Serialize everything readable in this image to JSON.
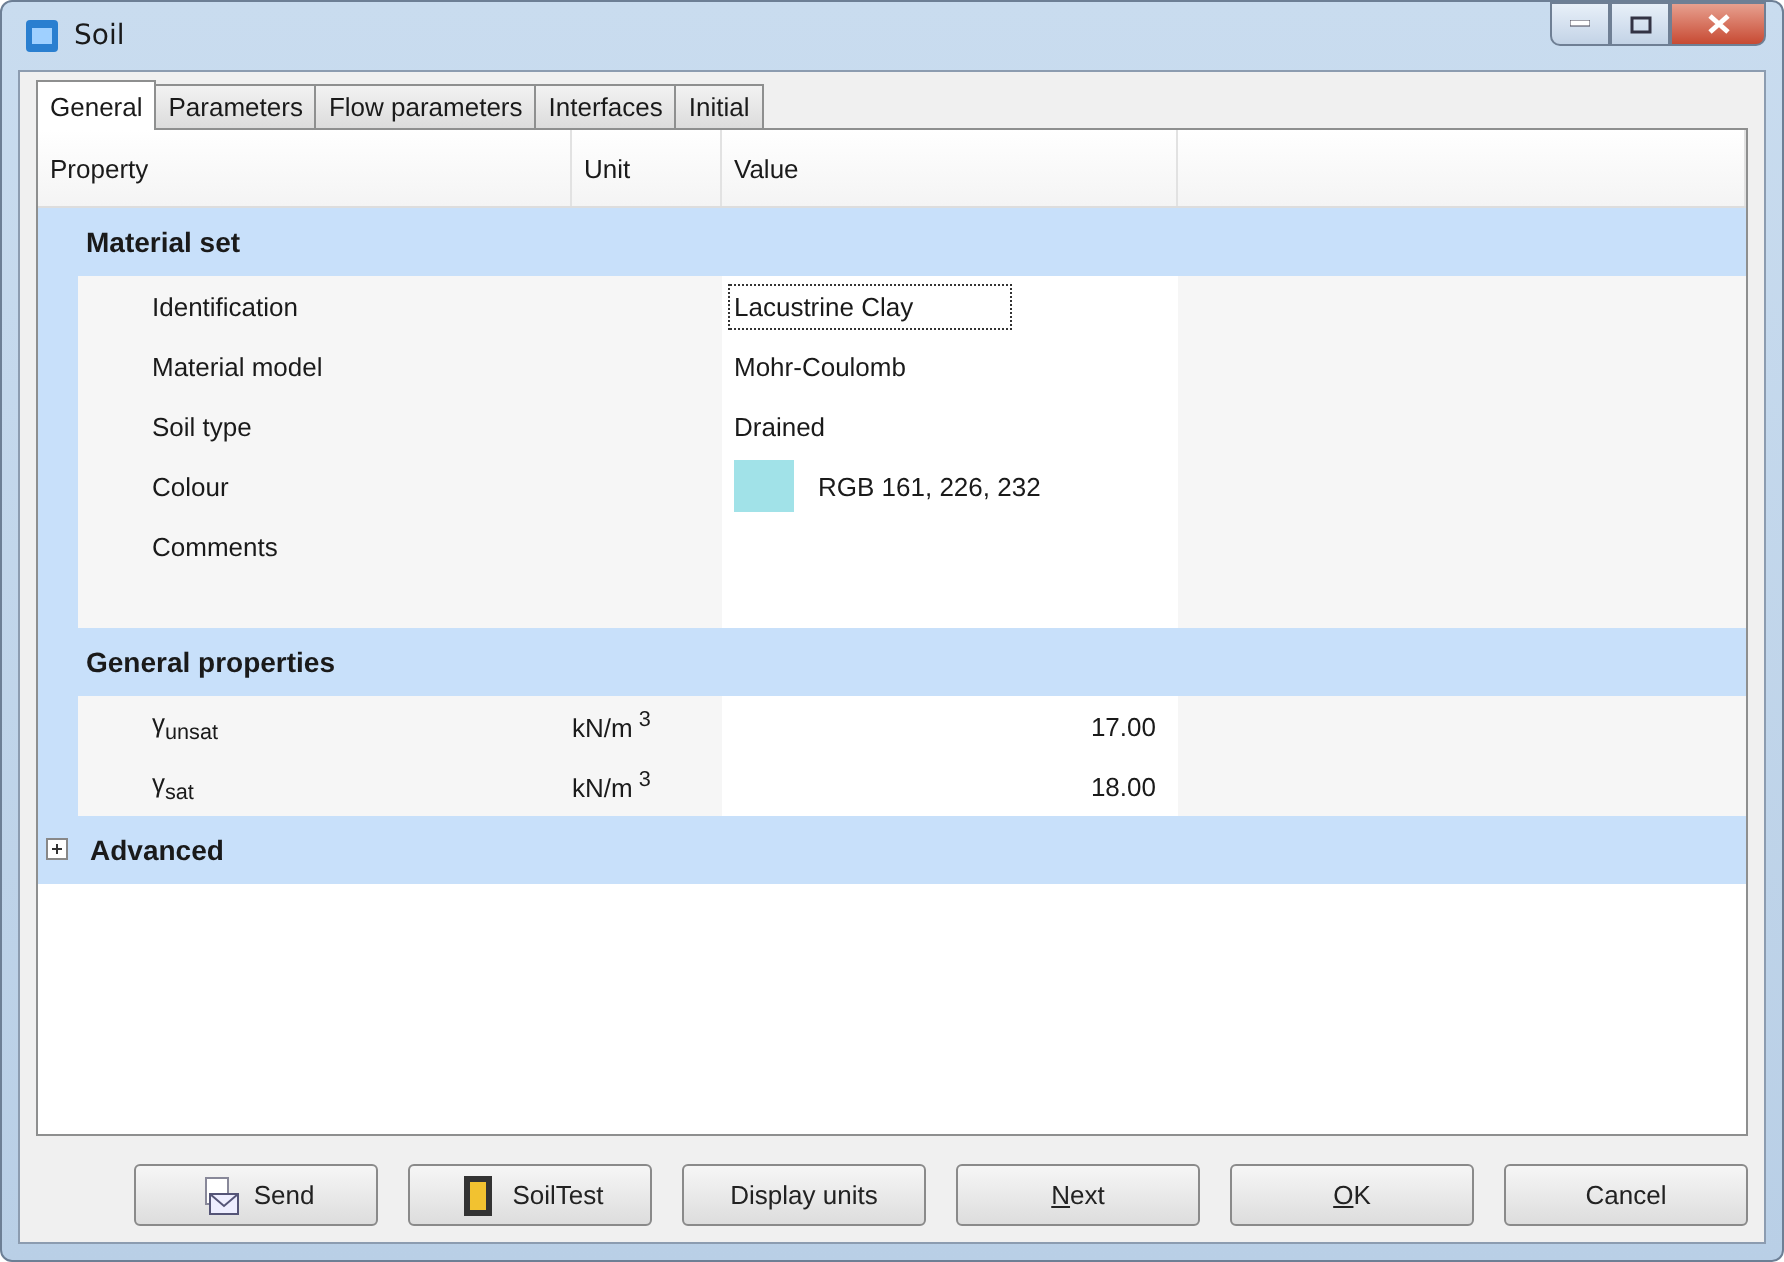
{
  "window": {
    "title": "Soil"
  },
  "tabs": [
    {
      "label": "General",
      "selected": true
    },
    {
      "label": "Parameters",
      "selected": false
    },
    {
      "label": "Flow parameters",
      "selected": false
    },
    {
      "label": "Interfaces",
      "selected": false
    },
    {
      "label": "Initial",
      "selected": false
    }
  ],
  "columns": [
    "Property",
    "Unit",
    "Value"
  ],
  "sections": [
    {
      "title": "Material set",
      "expanded": true,
      "rows": [
        {
          "kind": "text",
          "property": "Identification",
          "value": "Lacustrine Clay",
          "focused": true
        },
        {
          "kind": "text",
          "property": "Material model",
          "value": "Mohr-Coulomb",
          "focused": false
        },
        {
          "kind": "text",
          "property": "Soil type",
          "value": "Drained",
          "focused": false
        },
        {
          "kind": "color",
          "property": "Colour",
          "value": "RGB 161, 226, 232",
          "color": "#a1e2e8",
          "focused": false
        },
        {
          "kind": "memo",
          "property": "Comments"
        }
      ]
    },
    {
      "title": "General properties",
      "expanded": true,
      "rows": [
        {
          "kind": "number",
          "property": "γ$_{unsat}$",
          "unit": "kN/m$^{3}$",
          "value": "17.00",
          "focused": false
        },
        {
          "kind": "number",
          "property": "γ$_{sat}$",
          "unit": "kN/m$^{3}$",
          "value": "18.00",
          "focused": false
        }
      ]
    },
    {
      "title": "Advanced",
      "expanded": false
    }
  ],
  "buttons": [
    {
      "label": "Send",
      "underline_first": false
    },
    {
      "label": "SoilTest",
      "underline_first": false
    },
    {
      "label": "Display units",
      "underline_first": false
    },
    {
      "label": "Next",
      "underline_first": true
    },
    {
      "label": "OK",
      "underline_first": true
    },
    {
      "label": "Cancel",
      "underline_first": false
    }
  ]
}
